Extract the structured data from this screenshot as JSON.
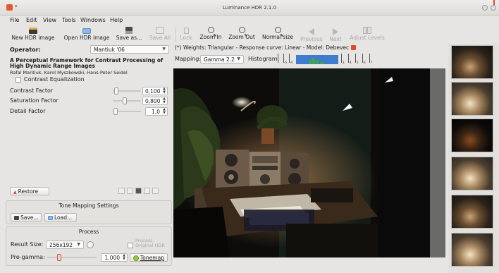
{
  "window": {
    "title": "Luminance HDR 2.1.0"
  },
  "menu": [
    "File",
    "Edit",
    "View",
    "Tools",
    "Windows",
    "Help"
  ],
  "toolbar": {
    "new_hdr": "New HDR image",
    "open_hdr": "Open HDR image",
    "save_as": "Save as...",
    "save_all": "Save All",
    "lock": "Lock",
    "zoom_in": "Zoom In",
    "zoom_out": "Zoom Out",
    "normal_size": "Normal size",
    "previous": "Previous",
    "next": "Next",
    "adjust_levels": "Adjust Levels"
  },
  "operator": {
    "label": "Operator:",
    "selected": "Mantiuk '06"
  },
  "paper": {
    "title": "A Perceptual Framework for Contrast Processing of High Dynamic Range Images",
    "authors": "Rafal Mantiuk, Karol Myszkowski, Hans-Peter Seidel"
  },
  "contrast_equalization": {
    "label": "Contrast Equalization",
    "checked": false
  },
  "params": [
    {
      "label": "Contrast Factor",
      "value": "0,100",
      "fraction": 0.05
    },
    {
      "label": "Saturation Factor",
      "value": "0,800",
      "fraction": 0.4
    },
    {
      "label": "Detail Factor",
      "value": "1,0",
      "fraction": 0.02
    }
  ],
  "restore_label": "Restore",
  "tone_settings": {
    "title": "Tone Mapping Settings",
    "save_label": "Save...",
    "load_label": "Load..."
  },
  "process": {
    "title": "Process",
    "result_size_label": "Result Size:",
    "result_size": "256x192",
    "process_original_line1": "Process",
    "process_original_line2": "Original HDR",
    "pregamma_label": "Pre-gamma:",
    "pregamma_value": "1,000",
    "pregamma_fraction": 0.22,
    "tonemap_label": "Tonemap"
  },
  "info_line": "(*) Weights: Triangular - Response curve: Linear - Model: Debevec",
  "mapping": {
    "label": "Mapping:",
    "selected": "Gamma 2.2"
  },
  "histogram": {
    "label": "Histogram:",
    "ticks": [
      "-5",
      "-4",
      "3",
      "4",
      "5",
      "6",
      "7"
    ]
  },
  "colors": {
    "accent_red": "#e04a2a",
    "hist_blue": "#3f7ccf",
    "hist_green": "#3fa84a",
    "tonemap_green": "#9bc93a"
  }
}
